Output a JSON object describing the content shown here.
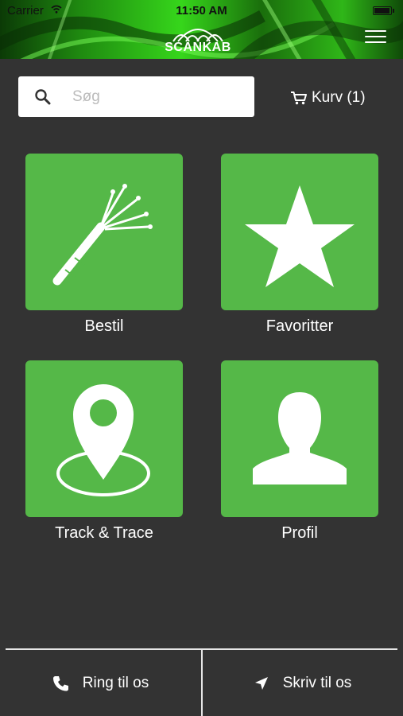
{
  "status_bar": {
    "carrier": "Carrier",
    "time": "11:50 AM"
  },
  "header": {
    "logo_text": "SCANKAB",
    "menu_icon": "hamburger-icon"
  },
  "search": {
    "placeholder": "Søg",
    "value": "",
    "icon": "search-icon"
  },
  "cart": {
    "label": "Kurv (1)",
    "icon": "cart-icon"
  },
  "tiles": [
    {
      "label": "Bestil",
      "icon": "cable-icon"
    },
    {
      "label": "Favoritter",
      "icon": "star-icon"
    },
    {
      "label": "Track & Trace",
      "icon": "location-pin-icon"
    },
    {
      "label": "Profil",
      "icon": "person-icon"
    }
  ],
  "bottom_bar": {
    "call": {
      "label": "Ring til os",
      "icon": "phone-icon"
    },
    "write": {
      "label": "Skriv til os",
      "icon": "send-arrow-icon"
    }
  },
  "colors": {
    "tile": "#55b848",
    "background": "#333333",
    "header_green": "#36d61b"
  }
}
